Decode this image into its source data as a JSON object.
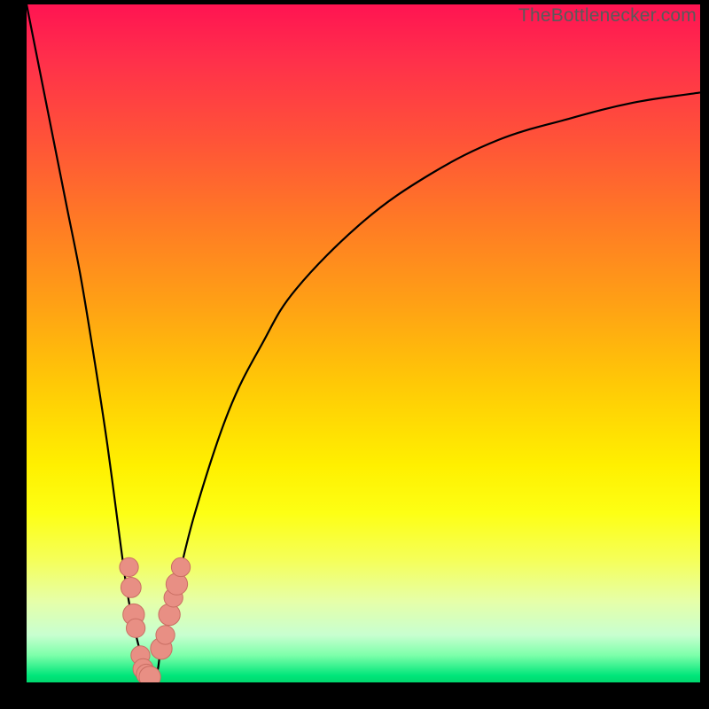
{
  "watermark": {
    "text": "TheBottlenecker.com"
  },
  "colors": {
    "curve": "#000000",
    "marker_fill": "#e88f84",
    "marker_stroke": "#c96e63",
    "frame": "#000000"
  },
  "chart_data": {
    "type": "line",
    "title": "",
    "xlabel": "",
    "ylabel": "",
    "xlim": [
      0,
      100
    ],
    "ylim": [
      0,
      100
    ],
    "grid": false,
    "legend": false,
    "series": [
      {
        "name": "bottleneck-curve",
        "x": [
          0,
          2,
          4,
          6,
          8,
          10,
          12,
          14,
          15,
          16,
          17,
          17.5,
          18,
          18.5,
          19,
          19.5,
          20,
          22,
          25,
          30,
          35,
          40,
          50,
          60,
          70,
          80,
          90,
          100
        ],
        "y": [
          100,
          90,
          80,
          70,
          60,
          48,
          35,
          20,
          13,
          8,
          4,
          2,
          0.5,
          0,
          0.5,
          2,
          5,
          13,
          25,
          40,
          50,
          58,
          68,
          75,
          80,
          83,
          85.5,
          87
        ]
      }
    ],
    "markers": [
      {
        "x": 15.2,
        "y": 17,
        "r": 1.4
      },
      {
        "x": 15.5,
        "y": 14,
        "r": 1.5
      },
      {
        "x": 15.9,
        "y": 10,
        "r": 1.6
      },
      {
        "x": 16.2,
        "y": 8,
        "r": 1.4
      },
      {
        "x": 16.9,
        "y": 4,
        "r": 1.4
      },
      {
        "x": 17.3,
        "y": 2,
        "r": 1.5
      },
      {
        "x": 17.8,
        "y": 1.2,
        "r": 1.5
      },
      {
        "x": 18.3,
        "y": 0.8,
        "r": 1.6
      },
      {
        "x": 20.0,
        "y": 5,
        "r": 1.6
      },
      {
        "x": 20.6,
        "y": 7,
        "r": 1.4
      },
      {
        "x": 21.2,
        "y": 10,
        "r": 1.6
      },
      {
        "x": 21.8,
        "y": 12.5,
        "r": 1.4
      },
      {
        "x": 22.3,
        "y": 14.5,
        "r": 1.6
      },
      {
        "x": 22.9,
        "y": 17,
        "r": 1.4
      }
    ]
  }
}
